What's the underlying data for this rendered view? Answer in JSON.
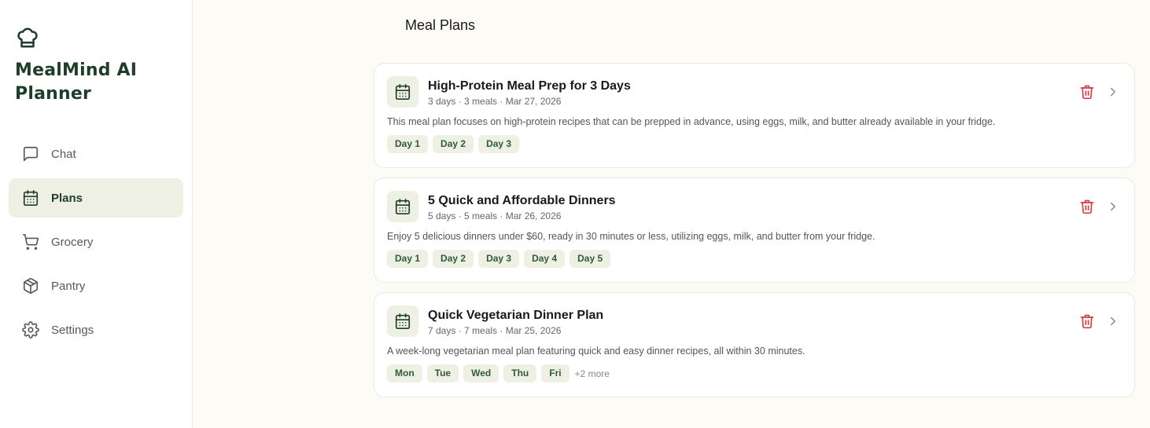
{
  "brand": {
    "name": "MealMind AI Planner",
    "icon": "chef-hat-icon"
  },
  "nav": [
    {
      "label": "Chat",
      "icon": "chat-icon",
      "active": false
    },
    {
      "label": "Plans",
      "icon": "calendar-icon",
      "active": true
    },
    {
      "label": "Grocery",
      "icon": "cart-icon",
      "active": false
    },
    {
      "label": "Pantry",
      "icon": "box-icon",
      "active": false
    },
    {
      "label": "Settings",
      "icon": "gear-icon",
      "active": false
    }
  ],
  "page": {
    "title": "Meal Plans"
  },
  "plans": [
    {
      "title": "High-Protein Meal Prep for 3 Days",
      "meta": "3 days · 3 meals · Mar 27, 2026",
      "description": "This meal plan focuses on high-protein recipes that can be prepped in advance, using eggs, milk, and butter already available in your fridge.",
      "tags": [
        "Day 1",
        "Day 2",
        "Day 3"
      ],
      "more": ""
    },
    {
      "title": "5 Quick and Affordable Dinners",
      "meta": "5 days · 5 meals · Mar 26, 2026",
      "description": "Enjoy 5 delicious dinners under $60, ready in 30 minutes or less, utilizing eggs, milk, and butter from your fridge.",
      "tags": [
        "Day 1",
        "Day 2",
        "Day 3",
        "Day 4",
        "Day 5"
      ],
      "more": ""
    },
    {
      "title": "Quick Vegetarian Dinner Plan",
      "meta": "7 days · 7 meals · Mar 25, 2026",
      "description": "A week-long vegetarian meal plan featuring quick and easy dinner recipes, all within 30 minutes.",
      "tags": [
        "Mon",
        "Tue",
        "Wed",
        "Thu",
        "Fri"
      ],
      "more": "+2 more"
    }
  ],
  "colors": {
    "accent": "#1f3d2b",
    "active_bg": "#eef0e4",
    "delete": "#d63c45",
    "page_bg": "#fcfbf5"
  }
}
